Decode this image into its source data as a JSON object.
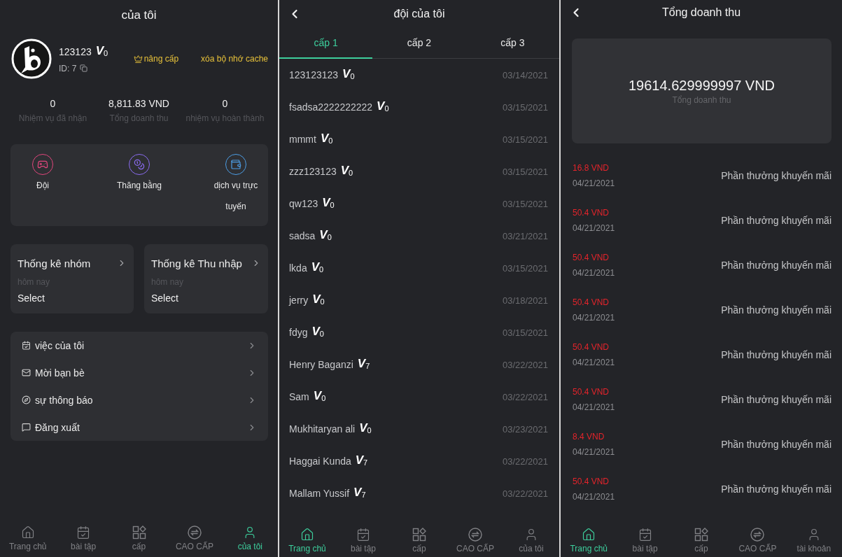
{
  "profile": {
    "title": "của tôi",
    "user": {
      "name": "123123",
      "badge": "V$_{0}$",
      "id": "ID: 7"
    },
    "actions": [
      {
        "kind": "upgrade",
        "label": "nâng cấp"
      },
      {
        "kind": "clear",
        "label": "xóa bộ nhớ cache"
      }
    ],
    "stats": [
      {
        "value": "0",
        "label": "Nhiệm vụ đã nhận"
      },
      {
        "value": "8,811.83 VND",
        "label": "Tổng doanh thu"
      },
      {
        "value": "0",
        "label": "nhiệm vụ hoàn thành"
      }
    ],
    "shortcuts": [
      {
        "label": "Đội",
        "color": "#e0467c"
      },
      {
        "label": "Thăng bằng",
        "color": "#8b6cf2"
      },
      {
        "label": "dịch vụ trực tuyến",
        "color": "#4c9ee6"
      }
    ],
    "stat_cards": [
      {
        "title": "Thống kê nhóm",
        "caption": "hôm nay",
        "value": "Select"
      },
      {
        "title": "Thống kê Thu nhập",
        "caption": "hôm nay",
        "value": "Select"
      }
    ],
    "menu": [
      {
        "label": "việc của tôi"
      },
      {
        "label": "Mời bạn bè"
      },
      {
        "label": "sự thông báo"
      },
      {
        "label": "Đăng xuất"
      }
    ],
    "tab_bar": [
      {
        "label": "Trang chủ",
        "selected": false
      },
      {
        "label": "bài tập",
        "selected": false
      },
      {
        "label": "cấp",
        "selected": false
      },
      {
        "label": "CAO CẤP",
        "selected": false
      },
      {
        "label": "của tôi",
        "selected": true
      }
    ]
  },
  "team": {
    "title": "đội của tôi",
    "tabs": [
      {
        "label": "cấp 1",
        "selected": true
      },
      {
        "label": "cấp 2",
        "selected": false
      },
      {
        "label": "cấp 3",
        "selected": false
      }
    ],
    "members": [
      {
        "name": "123123123",
        "badge": "V$_{0}$",
        "date": "03/14/2021"
      },
      {
        "name": "fsadsa2222222222",
        "badge": "V$_{0}$",
        "date": "03/15/2021"
      },
      {
        "name": "mmmt",
        "badge": "V$_{0}$",
        "date": "03/15/2021"
      },
      {
        "name": "zzz123123",
        "badge": "V$_{0}$",
        "date": "03/15/2021"
      },
      {
        "name": "qw123",
        "badge": "V$_{0}$",
        "date": "03/15/2021"
      },
      {
        "name": "sadsa",
        "badge": "V$_{0}$",
        "date": "03/21/2021"
      },
      {
        "name": "lkda",
        "badge": "V$_{0}$",
        "date": "03/15/2021"
      },
      {
        "name": "jerry",
        "badge": "V$_{0}$",
        "date": "03/18/2021"
      },
      {
        "name": "fdyg",
        "badge": "V$_{0}$",
        "date": "03/15/2021"
      },
      {
        "name": "Henry Baganzi",
        "badge": "V$_{7}$",
        "date": "03/22/2021"
      },
      {
        "name": "Sam",
        "badge": "V$_{0}$",
        "date": "03/22/2021"
      },
      {
        "name": "Mukhitaryan ali",
        "badge": "V$_{0}$",
        "date": "03/23/2021"
      },
      {
        "name": "Haggai Kunda",
        "badge": "V$_{7}$",
        "date": "03/22/2021"
      },
      {
        "name": "Mallam Yussif",
        "badge": "V$_{7}$",
        "date": "03/22/2021"
      }
    ],
    "tab_bar": [
      {
        "label": "Trang chủ",
        "selected": true
      },
      {
        "label": "bài tập",
        "selected": false
      },
      {
        "label": "cấp",
        "selected": false
      },
      {
        "label": "CAO CẤP",
        "selected": false
      },
      {
        "label": "của tôi",
        "selected": false
      }
    ]
  },
  "revenue": {
    "title": "Tổng doanh thu",
    "summary": {
      "amount": "19614.629999997 VND",
      "label": "Tổng doanh thu"
    },
    "entries": [
      {
        "amount": "16.8 VND",
        "date": "04/21/2021",
        "note": "Phần thưởng khuyến mãi"
      },
      {
        "amount": "50.4 VND",
        "date": "04/21/2021",
        "note": "Phần thưởng khuyến mãi"
      },
      {
        "amount": "50.4 VND",
        "date": "04/21/2021",
        "note": "Phần thưởng khuyến mãi"
      },
      {
        "amount": "50.4 VND",
        "date": "04/21/2021",
        "note": "Phần thưởng khuyến mãi"
      },
      {
        "amount": "50.4 VND",
        "date": "04/21/2021",
        "note": "Phần thưởng khuyến mãi"
      },
      {
        "amount": "50.4 VND",
        "date": "04/21/2021",
        "note": "Phần thưởng khuyến mãi"
      },
      {
        "amount": "8.4 VND",
        "date": "04/21/2021",
        "note": "Phần thưởng khuyến mãi"
      },
      {
        "amount": "50.4 VND",
        "date": "04/21/2021",
        "note": "Phần thưởng khuyến mãi"
      }
    ],
    "tab_bar": [
      {
        "label": "Trang chủ",
        "selected": true
      },
      {
        "label": "bài tập",
        "selected": false
      },
      {
        "label": "cấp",
        "selected": false
      },
      {
        "label": "CAO CẤP",
        "selected": false
      },
      {
        "label": "tài khoản",
        "selected": false
      }
    ]
  }
}
